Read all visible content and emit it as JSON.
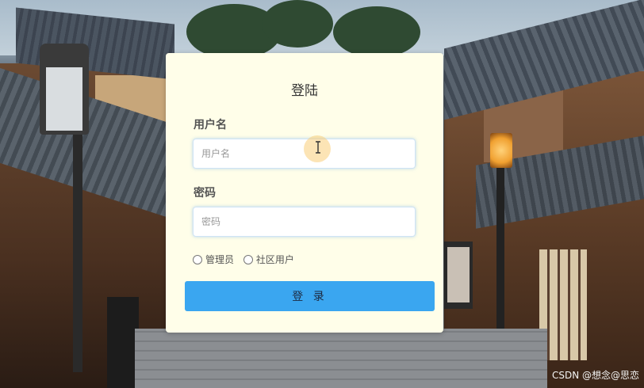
{
  "login": {
    "title": "登陆",
    "username_label": "用户名",
    "username_placeholder": "用户名",
    "password_label": "密码",
    "password_placeholder": "密码",
    "roles": [
      {
        "label": "管理员"
      },
      {
        "label": "社区用户"
      }
    ],
    "submit_label": "登 录"
  },
  "watermark": "CSDN @想念@思恋",
  "colors": {
    "card_bg": "#fffee9",
    "button_bg": "#3aa6f0",
    "input_border": "#cfe3f5"
  }
}
